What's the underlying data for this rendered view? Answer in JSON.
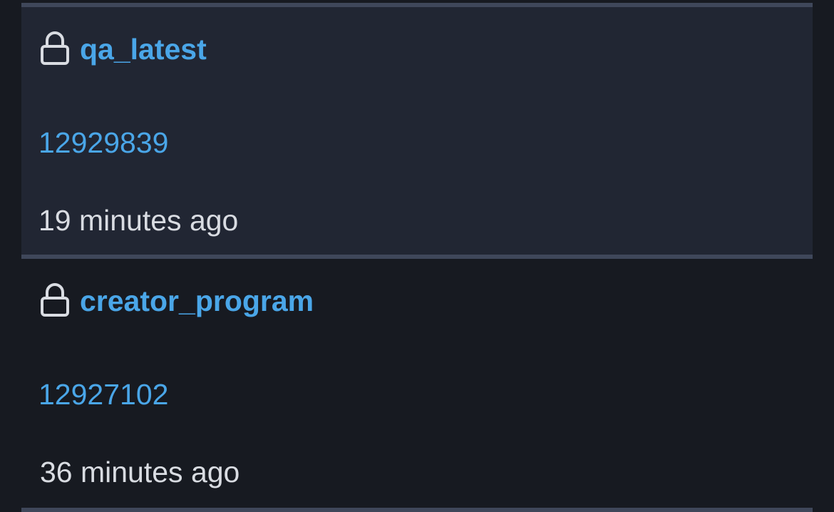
{
  "branches": [
    {
      "name": "qa_latest",
      "build_id": "12929839",
      "updated": "19 minutes ago",
      "icon": "lock-icon",
      "selected": true
    },
    {
      "name": "creator_program",
      "build_id": "12927102",
      "updated": "36 minutes ago",
      "icon": "lock-icon",
      "selected": false
    }
  ],
  "colors": {
    "background": "#171a21",
    "selected_row": "#212633",
    "divider": "#3f475a",
    "link": "#4aa6e8",
    "text": "#d9dce2",
    "icon": "#d9dce2"
  }
}
